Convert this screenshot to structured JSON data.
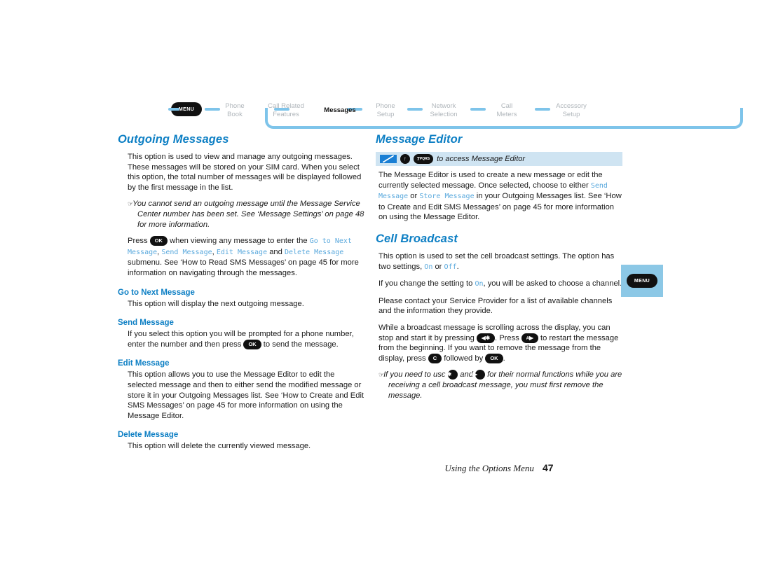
{
  "nav": {
    "menu_label": "MENU",
    "items": [
      {
        "label": "Phone\nBook",
        "active": false
      },
      {
        "label": "Call Related\nFeatures",
        "active": false
      },
      {
        "label": "Messages",
        "active": true
      },
      {
        "label": "Phone\nSetup",
        "active": false
      },
      {
        "label": "Network\nSelection",
        "active": false
      },
      {
        "label": "Call\nMeters",
        "active": false
      },
      {
        "label": "Accessory\nSetup",
        "active": false
      }
    ]
  },
  "left": {
    "heading": "Outgoing Messages",
    "p1": "This option is used to view and manage any outgoing messages. These messages will be stored on your SIM card. When you select this option, the total number of messages will be displayed followed by the first message in the list.",
    "note1": "You cannot send an outgoing message until the Message Service Center number has been set. See ‘Message Settings’ on page 48 for more information.",
    "press_prefix": "Press",
    "press_mid": "when viewing any message to enter the",
    "mono_goto": "Go to Next Message",
    "mono_send": "Send Message",
    "mono_edit": "Edit Message",
    "mono_delete": "Delete Message",
    "press_sep1": ",",
    "press_sep2": "and",
    "press_tail": "submenu. See ‘How to Read SMS Messages’ on page 45 for more information on navigating through the messages.",
    "sub1": "Go to Next Message",
    "sub1_p": "This option will display the next outgoing message.",
    "sub2": "Send Message",
    "sub2_a": "If you select this option you will be prompted for a phone number, enter the number and then press",
    "sub2_b": "to send the message.",
    "sub3": "Edit Message",
    "sub3_p": "This option allows you to use the Message Editor to edit the selected message and then to either send the modified message or store it in your Outgoing Messages list. See ‘How to Create and Edit SMS Messages’ on page 45 for more information on using the Message Editor.",
    "sub4": "Delete Message",
    "sub4_p": "This option will delete the currently viewed message."
  },
  "right": {
    "heading1": "Message Editor",
    "shortcut_text": "to access Message Editor",
    "shortcut_key_up": "↑",
    "shortcut_key_7": "7",
    "shortcut_key_7_sup": "PQRS",
    "p1_a": "The Message Editor is used to create a new message or edit the currently selected message. Once selected, choose to either",
    "mono_send": "Send Message",
    "p1_or": "or",
    "mono_store": "Store Message",
    "p1_b": "in your Outgoing Messages list. See ‘How to Create and Edit SMS Messages’ on page 45 for more information on using the Message Editor.",
    "heading2": "Cell Broadcast",
    "p2_a": "This option is used to set the cell broadcast settings. The option has two settings,",
    "mono_on": "On",
    "p2_or": "or",
    "mono_off": "Off",
    "p2_b": ".",
    "p3_a": "If you change the setting to",
    "p3_b": ", you will be asked to choose a channel.",
    "p4": "Please contact your Service Provider for a list of available channels and the information they provide.",
    "p5_a": "While a broadcast message is scrolling across the display, you can stop and start it by pressing",
    "p5_b": ". Press",
    "p5_c": "to restart the message from the beginning. If you want to remove the message from the display, press",
    "p5_d": "followed by",
    "p5_e": ".",
    "note_a": "If you need to use",
    "note_b": "and",
    "note_c": "for their normal functions while you are receiving a cell broadcast message, you must first remove the message.",
    "key_star": "◀✱",
    "key_hash": "#▶",
    "key_c": "C",
    "key_ok": "OK"
  },
  "tab": {
    "menu_label": "MENU"
  },
  "footer": {
    "text": "Using the Options Menu",
    "page": "47"
  }
}
